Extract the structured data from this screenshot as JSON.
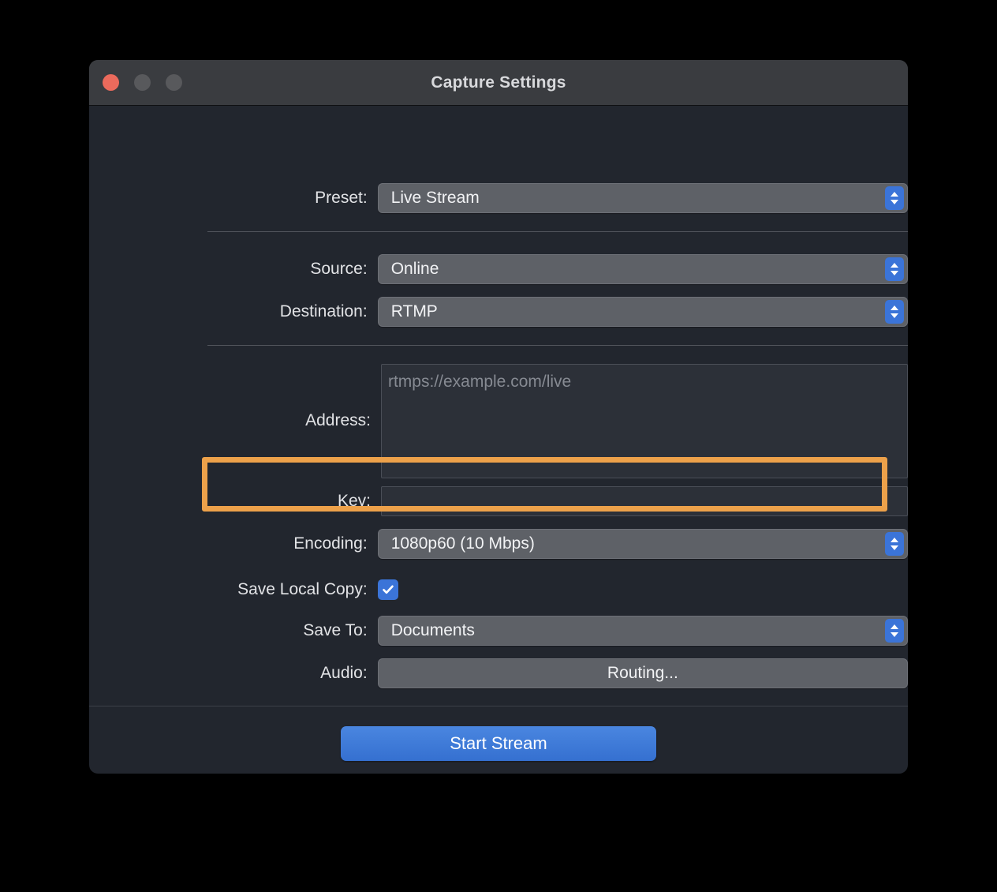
{
  "window": {
    "title": "Capture Settings",
    "traffic_lights": [
      {
        "name": "close",
        "color": "#eb6a5c"
      },
      {
        "name": "minimize",
        "color": "#58595c"
      },
      {
        "name": "maximize",
        "color": "#58595c"
      }
    ]
  },
  "form": {
    "preset": {
      "label": "Preset:",
      "value": "Live Stream",
      "control": "popup-button"
    },
    "source": {
      "label": "Source:",
      "value": "Online",
      "control": "popup-button"
    },
    "destination": {
      "label": "Destination:",
      "value": "RTMP",
      "control": "popup-button"
    },
    "address": {
      "label": "Address:",
      "value": "",
      "placeholder": "rtmps://example.com/live",
      "control": "text-area"
    },
    "key": {
      "label": "Key:",
      "value": "",
      "placeholder": "",
      "control": "text-field"
    },
    "encoding": {
      "label": "Encoding:",
      "value": "1080p60 (10 Mbps)",
      "control": "popup-button",
      "highlighted": true,
      "highlight_color": "#eda14a"
    },
    "save_local_copy": {
      "label": "Save Local Copy:",
      "checked": true,
      "control": "checkbox",
      "checkmark": "✓"
    },
    "save_to": {
      "label": "Save To:",
      "value": "Documents",
      "control": "popup-button"
    },
    "audio": {
      "label": "Audio:",
      "button_label": "Routing...",
      "control": "push-button"
    }
  },
  "footer": {
    "primary_button": "Start Stream"
  },
  "colors": {
    "window_background": "#22262e",
    "titlebar": "#3a3c40",
    "control_fill": "#5e6167",
    "field_fill": "#2c3038",
    "accent_blue": "#3b74d8",
    "highlight_orange": "#eda14a",
    "text_primary": "#e2e3e6",
    "text_placeholder": "#868a92"
  },
  "icons": {
    "stepper": "stepper-up-down-icon",
    "checkmark": "checkmark-icon"
  }
}
